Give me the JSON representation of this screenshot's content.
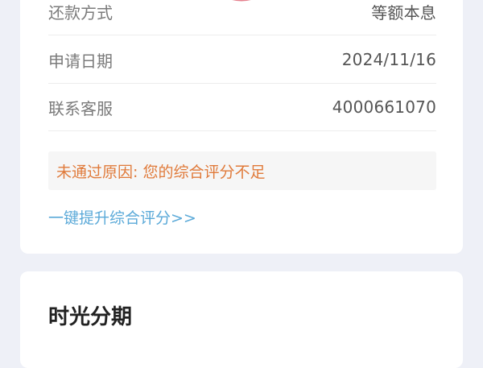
{
  "details": {
    "repayment_method": {
      "label": "还款方式",
      "value": "等额本息"
    },
    "application_date": {
      "label": "申请日期",
      "value": "2024/11/16"
    },
    "customer_service": {
      "label": "联系客服",
      "value": "4000661070"
    }
  },
  "status": {
    "reject_reason": "未通过原因: 您的综合评分不足",
    "improve_link": "一键提升综合评分>>"
  },
  "next_section": {
    "title": "时光分期"
  },
  "colors": {
    "accent_link": "#5aa9d8",
    "warning_text": "#e07a3a",
    "stamp": "#e06b7a",
    "background": "#eef0f7"
  },
  "icons": {
    "stamp": "approval-stamp-icon"
  }
}
